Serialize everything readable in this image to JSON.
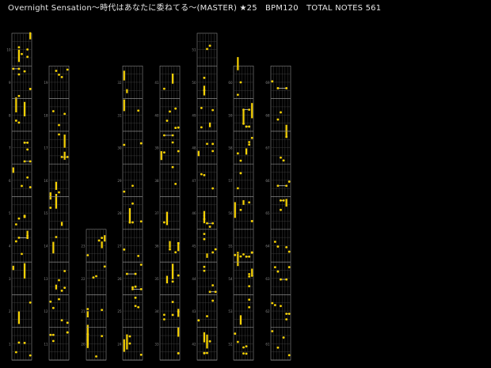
{
  "header": {
    "title": "Overnight Sensation～時代はあなたに委ねてる～(MASTER) ★25　BPM120　TOTAL NOTES 561"
  },
  "chart_data": {
    "type": "rhythm-game-score",
    "difficulty": "MASTER",
    "level": 25,
    "bpm": 120,
    "total_notes": 561,
    "lanes_per_column": 7,
    "colors": {
      "background": "#000000",
      "grid": "#3a3a3a",
      "measure_line": "#8a8a8a",
      "note": "#f5d000",
      "hold_bar": "#f5d000",
      "slide_line": "#ffffff",
      "label": "#8a8a8a"
    },
    "columns": [
      {
        "measure_labels": [
          "1",
          "2",
          "3",
          "4",
          "5",
          "6",
          "7",
          "8",
          "9",
          "10"
        ]
      },
      {
        "measure_labels": [
          "11",
          "12",
          "13",
          "14",
          "15",
          "16",
          "17",
          "18",
          "19"
        ]
      },
      {
        "measure_labels": [
          "20",
          "21",
          "22",
          "23"
        ]
      },
      {
        "measure_labels": [
          "24",
          "25",
          "26",
          "27",
          "28",
          "29",
          "30",
          "31",
          "32"
        ]
      },
      {
        "measure_labels": [
          "33",
          "34",
          "35",
          "36",
          "37",
          "38",
          "39",
          "40",
          "41"
        ]
      },
      {
        "measure_labels": [
          "42",
          "43",
          "44",
          "45",
          "46",
          "47",
          "48",
          "49",
          "50",
          "51"
        ]
      },
      {
        "measure_labels": [
          "52",
          "53",
          "54",
          "55",
          "56",
          "57",
          "58",
          "59",
          "60"
        ]
      },
      {
        "measure_labels": [
          "61",
          "62",
          "63",
          "64",
          "65",
          "66",
          "67",
          "68",
          "69"
        ]
      }
    ]
  }
}
